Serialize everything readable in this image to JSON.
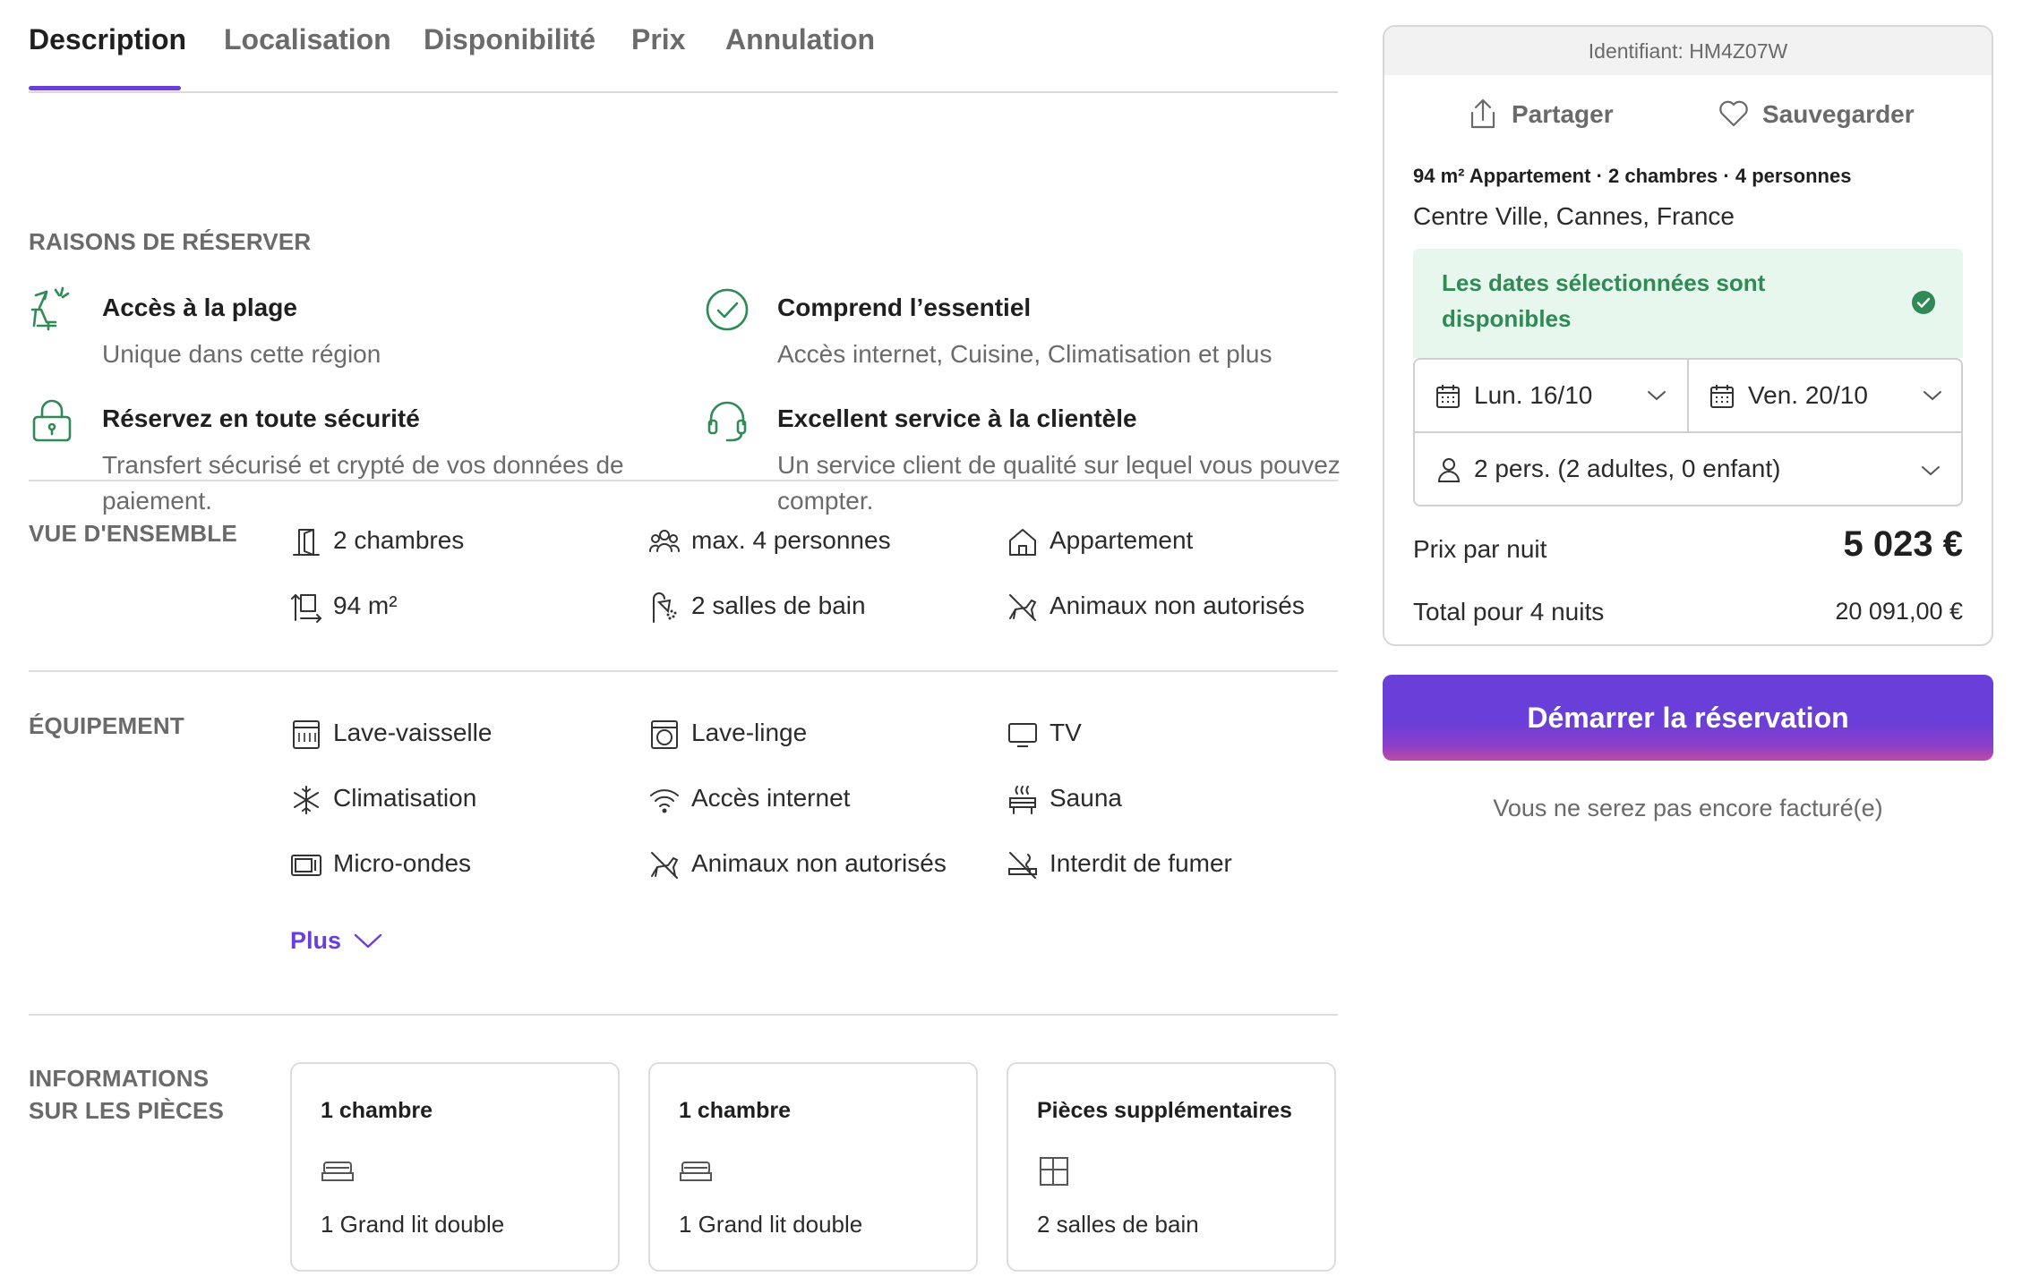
{
  "tabs": [
    {
      "label": "Description",
      "active": true
    },
    {
      "label": "Localisation",
      "active": false
    },
    {
      "label": "Disponibilité",
      "active": false
    },
    {
      "label": "Prix",
      "active": false
    },
    {
      "label": "Annulation",
      "active": false
    }
  ],
  "reasons": {
    "title": "RAISONS DE RÉSERVER",
    "items": [
      {
        "icon": "beach-icon",
        "title": "Accès à la plage",
        "desc": "Unique dans cette région"
      },
      {
        "icon": "check-circle-icon",
        "title": "Comprend l’essentiel",
        "desc": "Accès internet, Cuisine, Climatisation et plus"
      },
      {
        "icon": "lock-icon",
        "title": "Réservez en toute sécurité",
        "desc": "Transfert sécurisé et crypté de vos données de paiement."
      },
      {
        "icon": "headset-icon",
        "title": "Excellent service à la clientèle",
        "desc": "Un service client de qualité sur lequel vous pouvez compter."
      }
    ]
  },
  "overview": {
    "title": "VUE D'ENSEMBLE",
    "items": [
      {
        "icon": "door-icon",
        "label": "2 chambres"
      },
      {
        "icon": "people-icon",
        "label": "max. 4 personnes"
      },
      {
        "icon": "house-icon",
        "label": "Appartement"
      },
      {
        "icon": "area-icon",
        "label": "94 m²"
      },
      {
        "icon": "shower-icon",
        "label": "2 salles de bain"
      },
      {
        "icon": "no-pets-icon",
        "label": "Animaux non autorisés"
      }
    ]
  },
  "equipment": {
    "title": "ÉQUIPEMENT",
    "items": [
      {
        "icon": "dishwasher-icon",
        "label": "Lave-vaisselle"
      },
      {
        "icon": "washing-machine-icon",
        "label": "Lave-linge"
      },
      {
        "icon": "tv-icon",
        "label": "TV"
      },
      {
        "icon": "snowflake-icon",
        "label": "Climatisation"
      },
      {
        "icon": "wifi-icon",
        "label": "Accès internet"
      },
      {
        "icon": "sauna-icon",
        "label": "Sauna"
      },
      {
        "icon": "microwave-icon",
        "label": "Micro-ondes"
      },
      {
        "icon": "no-pets-icon",
        "label": "Animaux non autorisés"
      },
      {
        "icon": "no-smoking-icon",
        "label": "Interdit de fumer"
      }
    ],
    "more_label": "Plus"
  },
  "rooms": {
    "title": "INFORMATIONS SUR LES PIÈCES",
    "cards": [
      {
        "title": "1 chambre",
        "icon": "bed-icon",
        "desc": "1 Grand lit double"
      },
      {
        "title": "1 chambre",
        "icon": "bed-icon",
        "desc": "1 Grand lit double"
      },
      {
        "title": "Pièces supplémentaires",
        "icon": "floorplan-icon",
        "desc": "2 salles de bain"
      }
    ]
  },
  "booking": {
    "identifier": "Identifiant: HM4Z07W",
    "share_label": "Partager",
    "save_label": "Sauvegarder",
    "summary": "94 m² Appartement · 2 chambres · 4 personnes",
    "location": "Centre Ville, Cannes, France",
    "availability": "Les dates sélectionnées sont disponibles",
    "checkin": "Lun. 16/10",
    "checkout": "Ven. 20/10",
    "guests": "2 pers. (2 adultes, 0 enfant)",
    "price_label": "Prix par nuit",
    "price_value": "5 023 €",
    "total_label": "Total pour 4 nuits",
    "total_value": "20 091,00 €",
    "cta_label": "Démarrer la réservation",
    "note": "Vous ne serez pas encore facturé(e)"
  },
  "colors": {
    "accent": "#6a3fd9",
    "success": "#2f8a55",
    "success_bg": "#e8f7ee",
    "reason_icon": "#2f8a55"
  }
}
